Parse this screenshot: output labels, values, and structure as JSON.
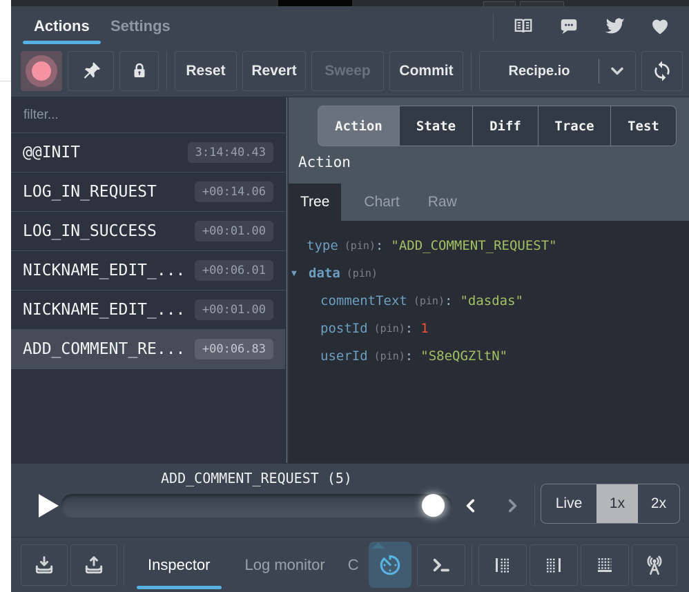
{
  "header": {
    "tabs": [
      {
        "label": "Actions"
      },
      {
        "label": "Settings"
      }
    ]
  },
  "toolbar": {
    "reset": "Reset",
    "revert": "Revert",
    "sweep": "Sweep",
    "commit": "Commit",
    "instance": "Recipe.io"
  },
  "action_list": {
    "filter_placeholder": "filter...",
    "items": [
      {
        "name": "@@INIT",
        "time": "3:14:40.43",
        "selected": false
      },
      {
        "name": "LOG_IN_REQUEST",
        "time": "+00:14.06",
        "selected": false
      },
      {
        "name": "LOG_IN_SUCCESS",
        "time": "+00:01.00",
        "selected": false
      },
      {
        "name": "NICKNAME_EDIT_...",
        "time": "+00:06.01",
        "selected": false
      },
      {
        "name": "NICKNAME_EDIT_...",
        "time": "+00:01.00",
        "selected": false
      },
      {
        "name": "ADD_COMMENT_RE...",
        "time": "+00:06.83",
        "selected": true
      }
    ]
  },
  "inspector": {
    "tabs": [
      {
        "label": "Action",
        "active": true
      },
      {
        "label": "State"
      },
      {
        "label": "Diff"
      },
      {
        "label": "Trace"
      },
      {
        "label": "Test"
      }
    ],
    "section_label": "Action",
    "subtabs": [
      {
        "label": "Tree",
        "active": true
      },
      {
        "label": "Chart"
      },
      {
        "label": "Raw"
      }
    ],
    "expander": "▼",
    "colon": ":",
    "tree": [
      {
        "key": "type",
        "pin": "(pin)",
        "value": "\"ADD_COMMENT_REQUEST\"",
        "value_type": "string"
      },
      {
        "key": "data",
        "pin": "(pin)",
        "expanded": true
      },
      {
        "key": "commentText",
        "pin": "(pin)",
        "value": "\"dasdas\"",
        "value_type": "string"
      },
      {
        "key": "postId",
        "pin": "(pin)",
        "value": "1",
        "value_type": "number"
      },
      {
        "key": "userId",
        "pin": "(pin)",
        "value": "\"S8eQGZltN\"",
        "value_type": "string"
      }
    ]
  },
  "player": {
    "label": "ADD_COMMENT_REQUEST (5)",
    "speeds": [
      {
        "label": "Live"
      },
      {
        "label": "1x",
        "active": true
      },
      {
        "label": "2x"
      }
    ]
  },
  "bottom_bar": {
    "tabs": [
      {
        "label": "Inspector",
        "active": true
      },
      {
        "label": "Log monitor"
      },
      {
        "label": "C"
      }
    ]
  },
  "icons": {
    "top": [
      "docs-book-icon",
      "chat-bubble-icon",
      "twitter-icon",
      "heart-icon"
    ],
    "toolbar": [
      "record-icon",
      "pin-icon",
      "lock-icon",
      "chevron-down-icon",
      "sync-icon"
    ],
    "player": [
      "play-icon",
      "chevron-left-icon",
      "chevron-right-icon"
    ],
    "bottom": [
      "import-tray-icon",
      "export-tray-icon",
      "stopwatch-icon",
      "terminal-icon",
      "dock-left-icon",
      "dock-right-icon",
      "dock-bottom-icon",
      "remote-antenna-icon"
    ]
  },
  "colors": {
    "accent_blue": "#55b2e2",
    "record_pink": "#f693a3",
    "key_blue": "#6d9fc0",
    "string_green": "#a3c162",
    "number_orange": "#f75032",
    "panel_bg": "#3b4450",
    "list_bg": "#2d333e",
    "content_bg": "#272c35",
    "right_header_bg": "#4b5560"
  }
}
